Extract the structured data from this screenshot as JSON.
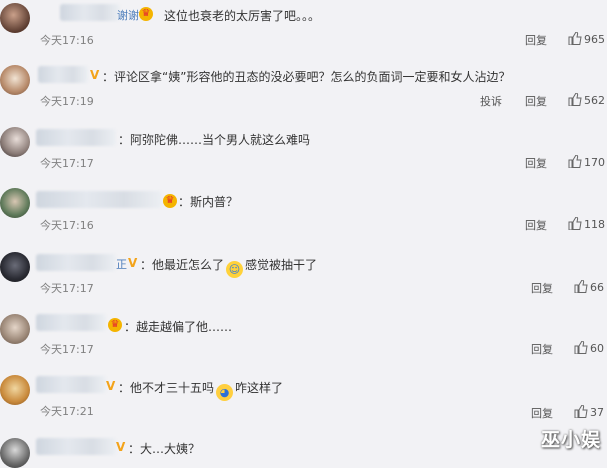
{
  "ui": {
    "reply_label": "回复",
    "report_label": "投诉"
  },
  "comments": [
    {
      "name_tail": "谢谢",
      "text": "这位也衰老的太厉害了吧。。。",
      "time": "今天17:16",
      "likes": "965"
    },
    {
      "text": "评论区拿“姨”形容他的丑态的没必要吧？怎么的负面词一定要和女人沾边？",
      "time": "今天17:19",
      "likes": "562"
    },
    {
      "text": "阿弥陀佛……当个男人就这么难吗",
      "time": "今天17:17",
      "likes": "170"
    },
    {
      "text": "斯内普？",
      "time": "今天17:16",
      "likes": "118"
    },
    {
      "name_tail": "正",
      "text_a": "他最近怎么了",
      "text_b": "感觉被抽干了",
      "time": "今天17:17",
      "likes": "66"
    },
    {
      "text": "越走越偏了他……",
      "time": "今天17:17",
      "likes": "60"
    },
    {
      "text_a": "他不才三十五吗",
      "text_b": "咋这样了",
      "time": "今天17:21",
      "likes": "37"
    },
    {
      "text": "大…大姨？"
    }
  ],
  "watermark": "巫小娱"
}
